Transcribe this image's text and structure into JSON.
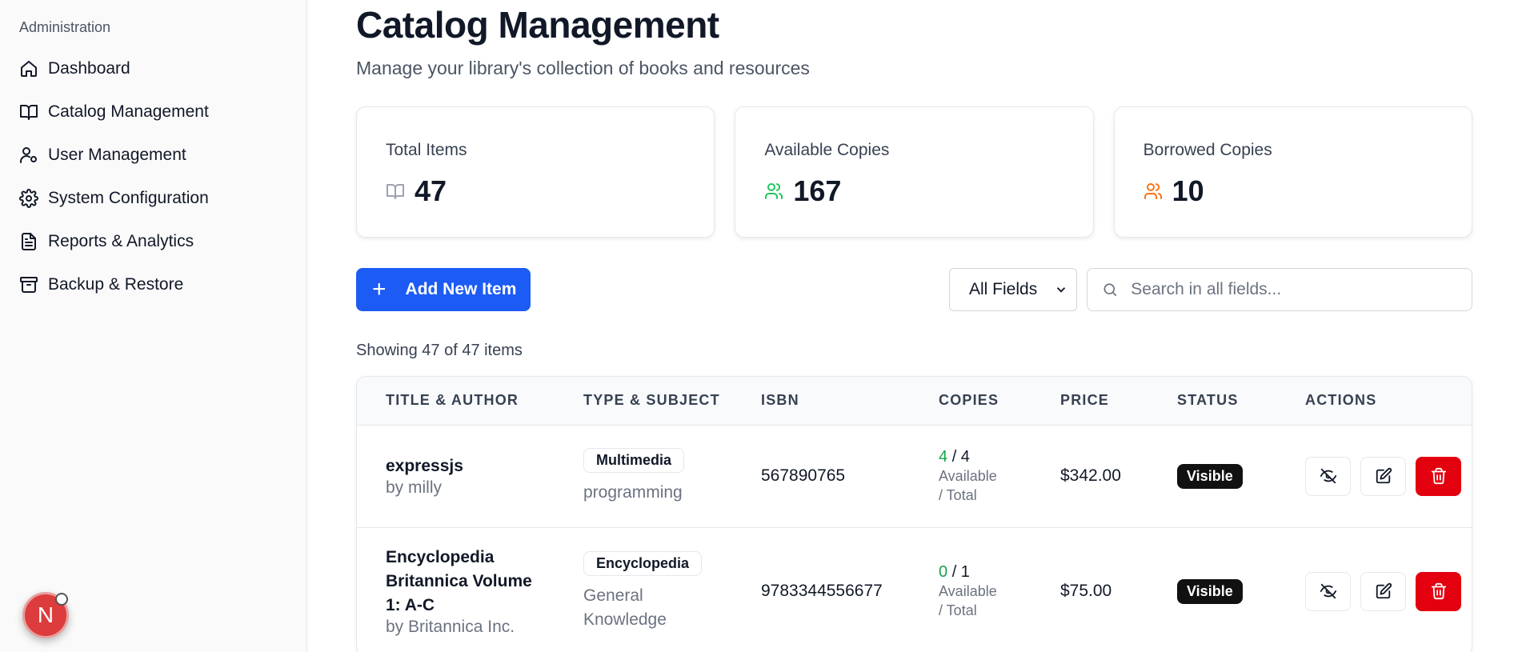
{
  "sidebar": {
    "section_label": "Administration",
    "items": [
      {
        "label": "Dashboard",
        "icon": "home-icon"
      },
      {
        "label": "Catalog Management",
        "icon": "book-open-icon"
      },
      {
        "label": "User Management",
        "icon": "user-cog-icon"
      },
      {
        "label": "System Configuration",
        "icon": "gear-icon"
      },
      {
        "label": "Reports & Analytics",
        "icon": "file-text-icon"
      },
      {
        "label": "Backup & Restore",
        "icon": "archive-icon"
      }
    ],
    "avatar_initial": "N"
  },
  "header": {
    "title": "Catalog Management",
    "subtitle": "Manage your library's collection of books and resources"
  },
  "stats": [
    {
      "label": "Total Items",
      "value": "47",
      "icon": "book-open-icon",
      "color": "#9ca3af"
    },
    {
      "label": "Available Copies",
      "value": "167",
      "icon": "users-icon",
      "color": "#22c55e"
    },
    {
      "label": "Borrowed Copies",
      "value": "10",
      "icon": "users-icon",
      "color": "#f97316"
    }
  ],
  "toolbar": {
    "add_label": "Add New Item",
    "field_select": "All Fields",
    "search_placeholder": "Search in all fields..."
  },
  "results_text": "Showing 47 of 47 items",
  "table": {
    "headers": [
      "TITLE & AUTHOR",
      "TYPE & SUBJECT",
      "ISBN",
      "COPIES",
      "PRICE",
      "STATUS",
      "ACTIONS"
    ],
    "rows": [
      {
        "title": "expressjs",
        "author": "by milly",
        "type": "Multimedia",
        "subject": "programming",
        "isbn": "567890765",
        "available": "4",
        "total": "/ 4",
        "copies_caption_1": "Available",
        "copies_caption_2": "/ Total",
        "price": "$342.00",
        "status": "Visible"
      },
      {
        "title": "Encyclopedia Britannica Volume 1: A-C",
        "author": "by Britannica Inc.",
        "type": "Encyclopedia",
        "subject": "General Knowledge",
        "isbn": "9783344556677",
        "available": "0",
        "total": "/ 1",
        "copies_caption_1": "Available",
        "copies_caption_2": "/ Total",
        "price": "$75.00",
        "status": "Visible"
      }
    ]
  },
  "colors": {
    "primary": "#1d5bf5",
    "danger": "#e3000f",
    "available_green": "#16a34a"
  }
}
